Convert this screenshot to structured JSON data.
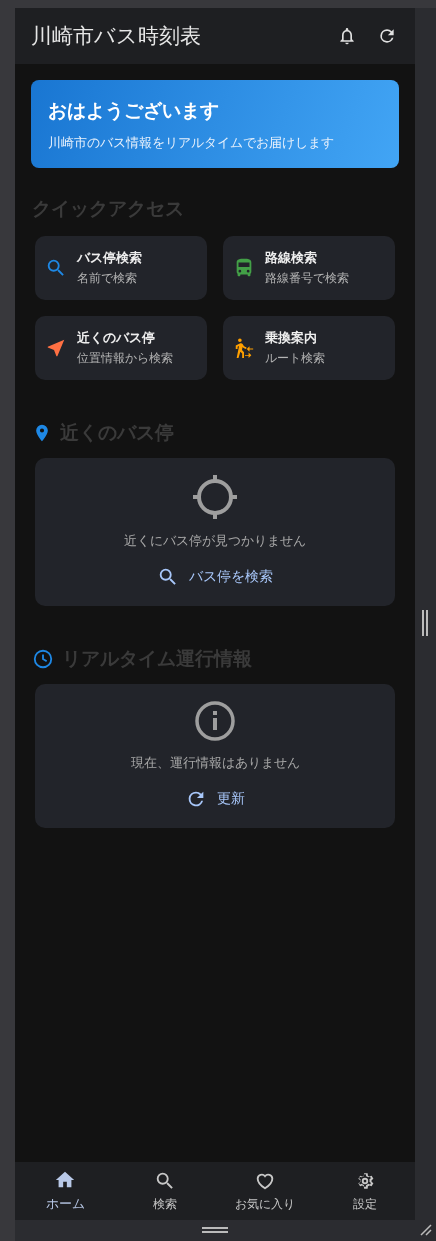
{
  "app_bar": {
    "title": "川崎市バス時刻表"
  },
  "greeting": {
    "title": "おはようございます",
    "subtitle": "川崎市のバス情報をリアルタイムでお届けします"
  },
  "quick_access": {
    "heading": "クイックアクセス",
    "items": [
      {
        "kind": "search",
        "color": "#1e88e5",
        "title": "バス停検索",
        "subtitle": "名前で検索"
      },
      {
        "kind": "bus",
        "color": "#43a047",
        "title": "路線検索",
        "subtitle": "路線番号で検索"
      },
      {
        "kind": "navigation",
        "color": "#ff7043",
        "title": "近くのバス停",
        "subtitle": "位置情報から検索"
      },
      {
        "kind": "transfer",
        "color": "#ffa000",
        "title": "乗換案内",
        "subtitle": "ルート検索"
      }
    ]
  },
  "sections": [
    {
      "kind": "nearby",
      "heading": "近くのバス停",
      "message": "近くにバス停が見つかりません",
      "action": {
        "kind": "search",
        "label": "バス停を検索"
      }
    },
    {
      "kind": "realtime",
      "heading": "リアルタイム運行情報",
      "message": "現在、運行情報はありません",
      "action": {
        "kind": "refresh",
        "label": "更新"
      }
    }
  ],
  "bottom_nav": [
    {
      "kind": "home",
      "label": "ホーム",
      "selected": true
    },
    {
      "kind": "search",
      "label": "検索",
      "selected": false
    },
    {
      "kind": "favorite",
      "label": "お気に入り",
      "selected": false
    },
    {
      "kind": "settings",
      "label": "設定",
      "selected": false
    }
  ]
}
